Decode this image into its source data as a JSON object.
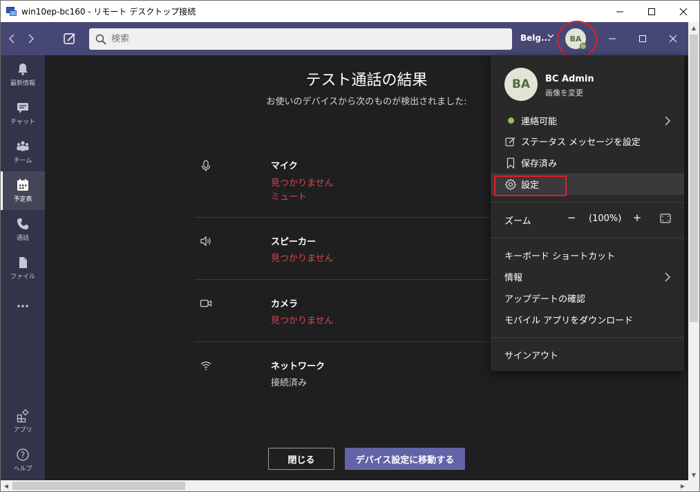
{
  "rdp": {
    "title": "win10ep-bc160 - リモート デスクトップ接続",
    "minimize": "—",
    "maximize": "☐",
    "close": "✕"
  },
  "teams": {
    "search_placeholder": "検索",
    "org": "Belg...",
    "avatar": "BA",
    "presence_color": "#92c353",
    "accent": "#464775"
  },
  "rail": [
    {
      "label": "最新情報",
      "icon": "bell-icon"
    },
    {
      "label": "チャット",
      "icon": "chat-icon"
    },
    {
      "label": "チーム",
      "icon": "teams-icon"
    },
    {
      "label": "予定表",
      "icon": "calendar-icon"
    },
    {
      "label": "通話",
      "icon": "phone-icon"
    },
    {
      "label": "ファイル",
      "icon": "file-icon"
    },
    {
      "label": "アプリ",
      "icon": "apps-icon"
    },
    {
      "label": "ヘルプ",
      "icon": "help-icon"
    }
  ],
  "main": {
    "title": "テスト通話の結果",
    "subtitle": "お使いのデバイスから次のものが検出されました:",
    "devices": [
      {
        "name": "マイク",
        "status1": "見つかりません",
        "status2": "ミュート",
        "icon": "microphone-icon"
      },
      {
        "name": "スピーカー",
        "status1": "見つかりません",
        "icon": "speaker-icon"
      },
      {
        "name": "カメラ",
        "status1": "見つかりません",
        "icon": "camera-icon"
      },
      {
        "name": "ネットワーク",
        "status1": "接続済み",
        "icon": "wifi-icon"
      }
    ],
    "close_button": "閉じる",
    "device_settings_button": "デバイス設定に移動する"
  },
  "menu": {
    "avatar": "BA",
    "name": "BC Admin",
    "change_picture": "画像を変更",
    "status": "連絡可能",
    "status_message": "ステータス メッセージを設定",
    "saved": "保存済み",
    "settings": "設定",
    "zoom_label": "ズーム",
    "zoom_minus": "−",
    "zoom_value": "(100%)",
    "zoom_plus": "+",
    "keyboard_shortcuts": "キーボード ショートカット",
    "about": "情報",
    "check_updates": "アップデートの確認",
    "download_mobile": "モバイル アプリをダウンロード",
    "sign_out": "サインアウト"
  }
}
